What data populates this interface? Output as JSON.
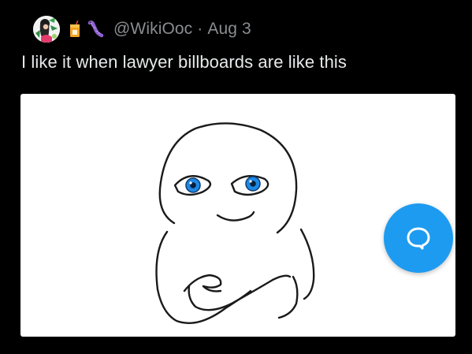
{
  "post": {
    "author": {
      "handle": "@WikiOoc",
      "separator": "·",
      "date": "Aug 3",
      "avatar_icon": "avatar-icon",
      "name_emojis": [
        "beverage-box-icon",
        "worm-icon"
      ]
    },
    "text": "I like it when lawyer billboards are like this",
    "media": {
      "kind": "drawing",
      "subject_icon": "doodle-face-icon",
      "eye_color": "#1e88e5"
    }
  },
  "reply_fab": {
    "icon": "speech-bubble-icon",
    "color": "#1d9bf0"
  },
  "colors": {
    "background": "#000000",
    "text": "#e7e9ea",
    "muted": "#8a8d91",
    "accent": "#1d9bf0"
  }
}
